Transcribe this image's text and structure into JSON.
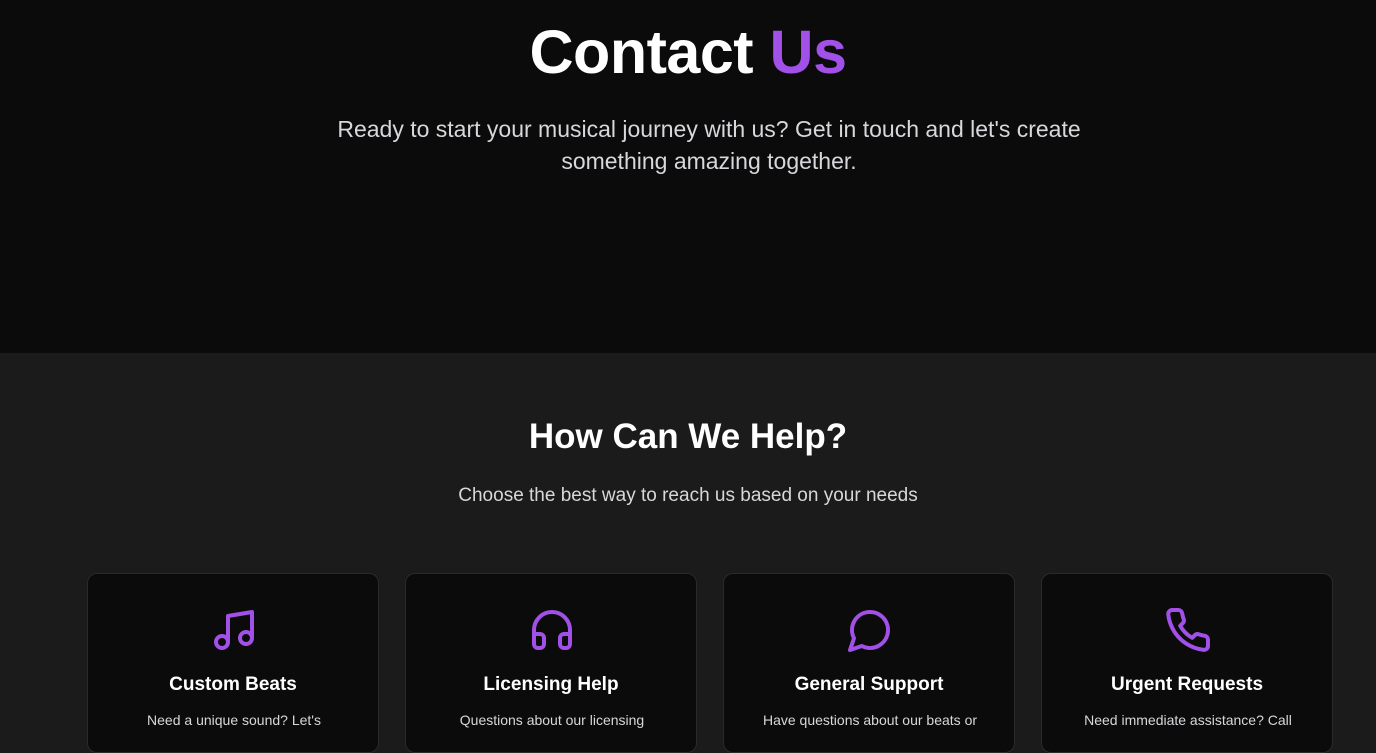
{
  "colors": {
    "accent": "#a251e8",
    "hero_background": "#0b0b0b",
    "section_background": "#1b1b1b",
    "card_background": "#0b0b0b"
  },
  "hero": {
    "title_main": "Contact",
    "title_accent": "Us",
    "subtitle": "Ready to start your musical journey with us? Get in touch and let's create something amazing together."
  },
  "help": {
    "title": "How Can We Help?",
    "subtitle": "Choose the best way to reach us based on your needs",
    "cards": [
      {
        "icon": "music-note-icon",
        "title": "Custom Beats",
        "description": "Need a unique sound? Let's"
      },
      {
        "icon": "headphones-icon",
        "title": "Licensing Help",
        "description": "Questions about our licensing"
      },
      {
        "icon": "chat-bubble-icon",
        "title": "General Support",
        "description": "Have questions about our beats or"
      },
      {
        "icon": "phone-icon",
        "title": "Urgent Requests",
        "description": "Need immediate assistance? Call"
      }
    ]
  }
}
